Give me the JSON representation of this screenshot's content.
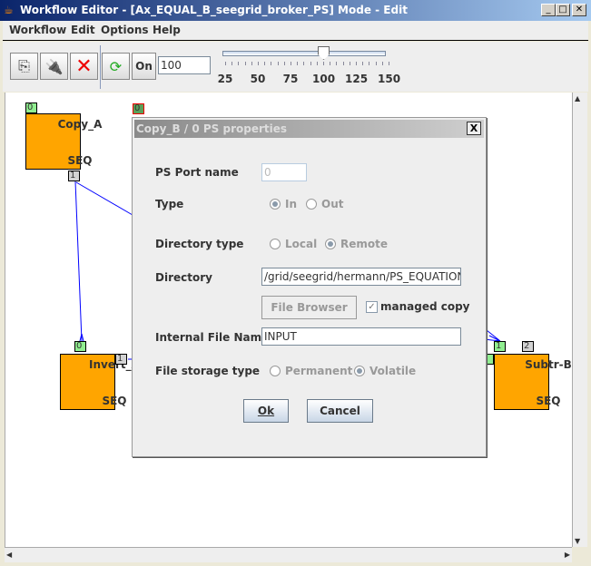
{
  "window": {
    "title": "Workflow Editor - [Ax_EQUAL_B_seegrid_broker_PS]  Mode - Edit",
    "minimize": "_",
    "maximize": "□",
    "close": "✕"
  },
  "menu": [
    "Workflow",
    "Edit",
    "Options",
    "Help"
  ],
  "toolbar": {
    "on_label": "On",
    "zoom_value": "100",
    "slider_value": 100,
    "slider_ticks": [
      "25",
      "50",
      "75",
      "100",
      "125",
      "150"
    ]
  },
  "nodes": [
    {
      "name": "Copy_A",
      "type": "SEQ",
      "in": "0",
      "out": "1"
    },
    {
      "name": "Invert_A",
      "type": "SEQ",
      "in": "0",
      "out": "1"
    },
    {
      "name": "Subtr-B",
      "type": "SEQ",
      "in": "1",
      "in2": "2"
    }
  ],
  "copy_b_port": "0",
  "dialog": {
    "title": "Copy_B / 0 PS properties",
    "close": "X",
    "port_name_label": "PS Port name",
    "port_name_value": "0",
    "type_label": "Type",
    "type_in": "In",
    "type_out": "Out",
    "dir_type_label": "Directory type",
    "dir_local": "Local",
    "dir_remote": "Remote",
    "directory_label": "Directory",
    "directory_value": "/grid/seegrid/hermann/PS_EQUATION_",
    "file_browser": "File Browser",
    "managed_copy": "managed copy",
    "managed_copy_checked": true,
    "internal_label": "Internal File Name",
    "internal_value": "INPUT",
    "storage_label": "File storage type",
    "storage_perm": "Permanent",
    "storage_vol": "Volatile",
    "ok": "Ok",
    "cancel": "Cancel"
  },
  "colors": {
    "node": "#ffa500",
    "port_in": "#90ee90",
    "port_out": "#d3d3d3",
    "edge": "#0000ff"
  }
}
